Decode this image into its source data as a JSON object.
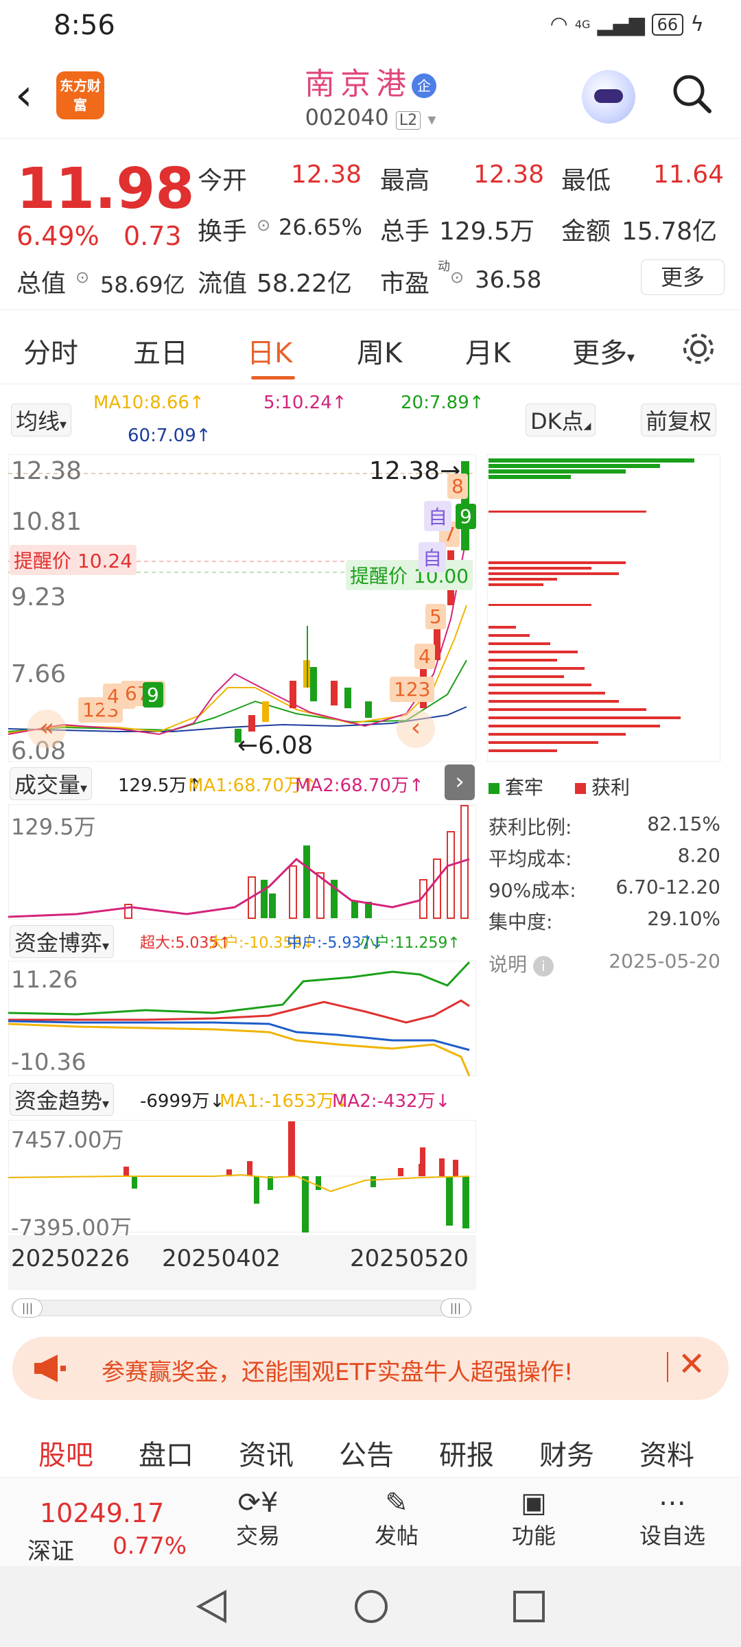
{
  "status": {
    "time": "8:56",
    "battery": "66",
    "network": "4G"
  },
  "header": {
    "back_icon": "chevron-left-icon",
    "logo_text": "东方财富",
    "stock_name": "南京港",
    "stock_badge": "企",
    "stock_code": "002040",
    "level": "L2"
  },
  "quote": {
    "price": "11.98",
    "change_pct": "6.49%",
    "change": "0.73",
    "open_label": "今开",
    "open": "12.38",
    "high_label": "最高",
    "high": "12.38",
    "low_label": "最低",
    "low": "11.64",
    "turnover_label": "换手",
    "turnover": "26.65%",
    "volume_label": "总手",
    "volume": "129.5万",
    "amount_label": "金额",
    "amount": "15.78亿",
    "mktcap_label": "总值",
    "mktcap": "58.69亿",
    "float_label": "流值",
    "float": "58.22亿",
    "pe_label": "市盈",
    "pe_sup": "动",
    "pe": "36.58",
    "more": "更多"
  },
  "tabs": [
    "分时",
    "五日",
    "日K",
    "周K",
    "月K",
    "更多"
  ],
  "kline": {
    "ma_selector": "均线",
    "ma10": "MA10:8.66↑",
    "ma5": "5:10.24↑",
    "ma20": "20:7.89↑",
    "ma60": "60:7.09↑",
    "dk": "DK点",
    "fuquan": "前复权",
    "y_labels": [
      "12.38",
      "10.81",
      "9.23",
      "7.66",
      "6.08"
    ],
    "high_marker": "12.38",
    "low_marker": "6.08",
    "alert1": "提醒价 10.24",
    "alert2": "提醒价 10.00",
    "seq_nums": [
      "123",
      "45",
      "678",
      "9",
      "123",
      "4",
      "5",
      "6",
      "7",
      "8",
      "9"
    ],
    "zi": "自"
  },
  "volume": {
    "selector": "成交量",
    "v": "129.5万↑",
    "ma1": "MA1:68.70万↑",
    "ma2": "MA2:68.70万↑",
    "ymax": "129.5万"
  },
  "fund": {
    "selector": "资金博弈",
    "super": "超大:5.035↑",
    "big": "大户:-10.356↓",
    "mid": "中户:-5.937↓",
    "small": "小户:11.259↑",
    "ymax": "11.26",
    "ymin": "-10.36"
  },
  "trend": {
    "selector": "资金趋势",
    "v": "-6999万↓",
    "ma1": "MA1:-1653万↓",
    "ma2": "MA2:-432万↓",
    "ymax": "7457.00万",
    "ymin": "-7395.00万"
  },
  "dates": [
    "20250226",
    "20250402",
    "20250520"
  ],
  "chips": {
    "legend_trapped": "套牢",
    "legend_profit": "获利",
    "rows": [
      {
        "label": "获利比例:",
        "value": "82.15%"
      },
      {
        "label": "平均成本:",
        "value": "8.20"
      },
      {
        "label": "90%成本:",
        "value": "6.70-12.20"
      },
      {
        "label": "集中度:",
        "value": "29.10%"
      }
    ],
    "note": "说明",
    "date": "2025-05-20"
  },
  "banner": {
    "text": "参赛赢奖金，还能围观ETF实盘牛人超强操作!"
  },
  "bottom_tabs": [
    "股吧",
    "盘口",
    "资讯",
    "公告",
    "研报",
    "财务",
    "资料"
  ],
  "bottom_bar": {
    "index_value": "10249.17",
    "index_name": "深证",
    "index_pct": "0.77%",
    "trade": "交易",
    "post": "发帖",
    "func": "功能",
    "watch": "设自选"
  },
  "colors": {
    "accent": "#e8622a",
    "up": "#e0302f",
    "down": "#1aa01a",
    "ma10": "#f0b400",
    "ma5": "#d4237a",
    "ma20": "#1aa01a",
    "ma60": "#1c3c9c"
  }
}
